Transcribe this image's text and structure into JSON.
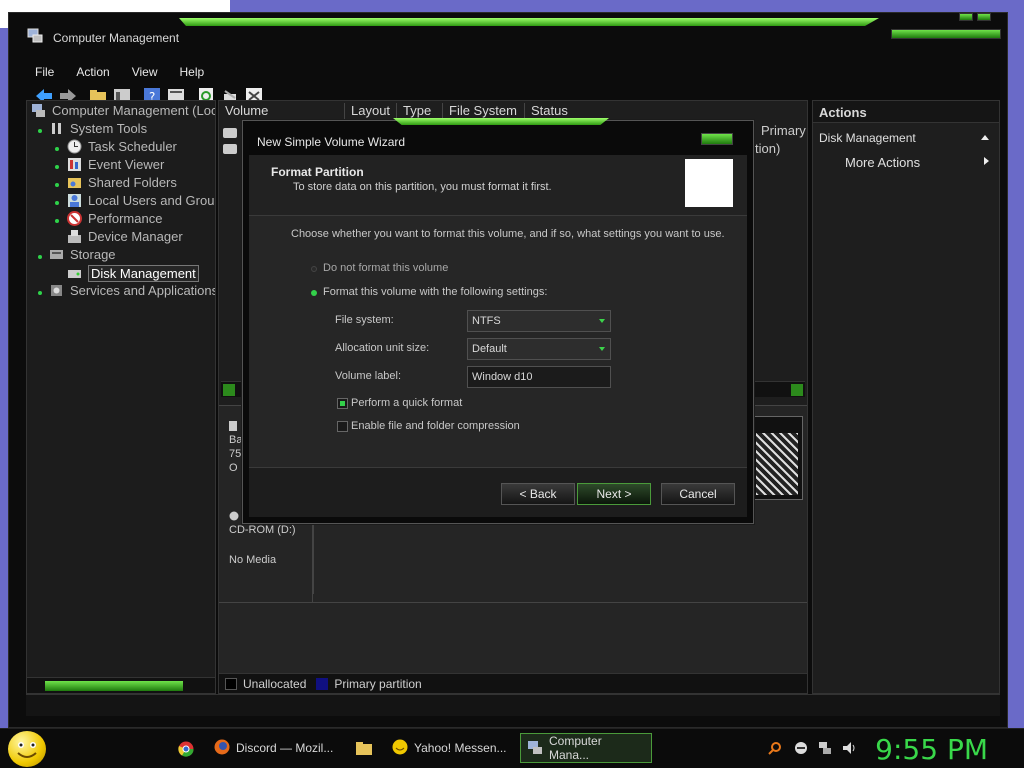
{
  "window": {
    "title": "Computer Management"
  },
  "menu": [
    "File",
    "Action",
    "View",
    "Help"
  ],
  "tree": {
    "root": "Computer Management (Loc",
    "system_tools": "System Tools",
    "task_scheduler": "Task Scheduler",
    "event_viewer": "Event Viewer",
    "shared_folders": "Shared Folders",
    "local_users": "Local Users and Grou",
    "performance": "Performance",
    "device_manager": "Device Manager",
    "storage": "Storage",
    "disk_management": "Disk Management",
    "services": "Services and Applications"
  },
  "columns": {
    "volume": "Volume",
    "layout": "Layout",
    "type": "Type",
    "file_system": "File System",
    "status": "Status",
    "partial_primary": "Primary",
    "partial_tion": "tion)"
  },
  "lower": {
    "disk_partial_1": "Ba",
    "disk_partial_2": "75",
    "disk_partial_3": "O",
    "cdrom_label": "CD-ROM (D:)",
    "cdrom_status": "No Media"
  },
  "legend": {
    "unallocated": "Unallocated",
    "primary": "Primary partition"
  },
  "actions": {
    "header": "Actions",
    "disk_management": "Disk Management",
    "more_actions": "More Actions"
  },
  "dialog": {
    "title": "New Simple Volume Wizard",
    "header_title": "Format Partition",
    "header_sub": "To store data on this partition, you must format it first.",
    "instruction": "Choose whether you want to format this volume, and if so, what settings you want to use.",
    "opt_no_format": "Do not format this volume",
    "opt_format": "Format this volume with the following settings:",
    "file_system_label": "File system:",
    "file_system_value": "NTFS",
    "alloc_label": "Allocation unit size:",
    "alloc_value": "Default",
    "volume_label_label": "Volume label:",
    "volume_label_value": "Window d10",
    "quick_format": "Perform a quick format",
    "compression": "Enable file and folder compression",
    "back": "< Back",
    "next": "Next >",
    "cancel": "Cancel"
  },
  "taskbar": {
    "task_discord": "Discord — Mozil...",
    "task_yahoo": "Yahoo! Messen...",
    "task_computer": "Computer Mana...",
    "clock": "9:55 PM"
  },
  "colors": {
    "accent_green": "#39d84a",
    "desktop": "#6a6ac8"
  }
}
